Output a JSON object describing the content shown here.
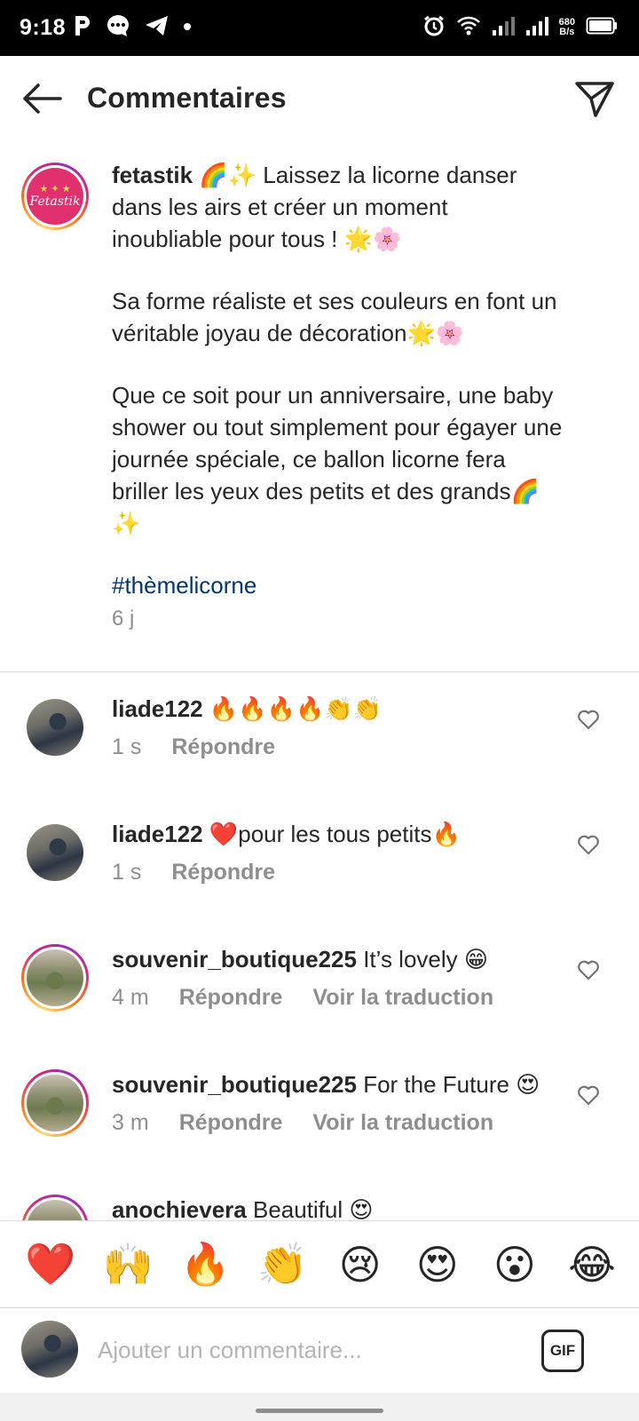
{
  "status_bar": {
    "time": "9:18",
    "net_speed_value": "680",
    "net_speed_unit": "B/s",
    "left_icons": [
      "parking-icon",
      "chat-bubble-icon",
      "telegram-icon",
      "dot-icon"
    ],
    "right_icons": [
      "alarm-icon",
      "wifi-icon",
      "signal-icon",
      "signal-icon",
      "battery-icon"
    ]
  },
  "header": {
    "title": "Commentaires",
    "back_icon": "arrow-left-icon",
    "share_icon": "send-icon"
  },
  "caption": {
    "username": "fetastik",
    "avatar_label": "Fetastik",
    "paragraph1": "🌈✨ Laissez la licorne danser dans les airs et créer un moment inoubliable pour tous ! 🌟🌸",
    "paragraph2": "Sa forme réaliste et ses couleurs en font un véritable joyau de décoration🌟🌸",
    "paragraph3": "Que ce soit pour un anniversaire, une baby shower ou tout simplement pour égayer une journée spéciale, ce ballon licorne fera briller les yeux des petits et des grands🌈✨",
    "hashtag": "#thèmelicorne",
    "time": "6 j"
  },
  "comments": [
    {
      "username": "liade122",
      "text": "🔥🔥🔥🔥👏👏",
      "time": "1 s",
      "reply": "Répondre",
      "translate": ""
    },
    {
      "username": "liade122",
      "text": "❤️pour les tous petits🔥",
      "time": "1 s",
      "reply": "Répondre",
      "translate": ""
    },
    {
      "username": "souvenir_boutique225",
      "text": "It’s lovely 😁",
      "time": "4 m",
      "reply": "Répondre",
      "translate": "Voir la traduction"
    },
    {
      "username": "souvenir_boutique225",
      "text": "For the Future 😍",
      "time": "3 m",
      "reply": "Répondre",
      "translate": "Voir la traduction"
    },
    {
      "username": "anochievera",
      "text": "Beautiful 😍",
      "time": "",
      "reply": "",
      "translate": ""
    }
  ],
  "emoji_bar": [
    "❤️",
    "🙌",
    "🔥",
    "👏",
    "😢",
    "😍",
    "😮",
    "😂"
  ],
  "comment_input": {
    "placeholder": "Ajouter un commentaire...",
    "gif_label": "GIF"
  },
  "colors": {
    "hashtag": "#00376b",
    "secondary_text": "#8e8e8e",
    "divider": "#dbdbdb"
  }
}
